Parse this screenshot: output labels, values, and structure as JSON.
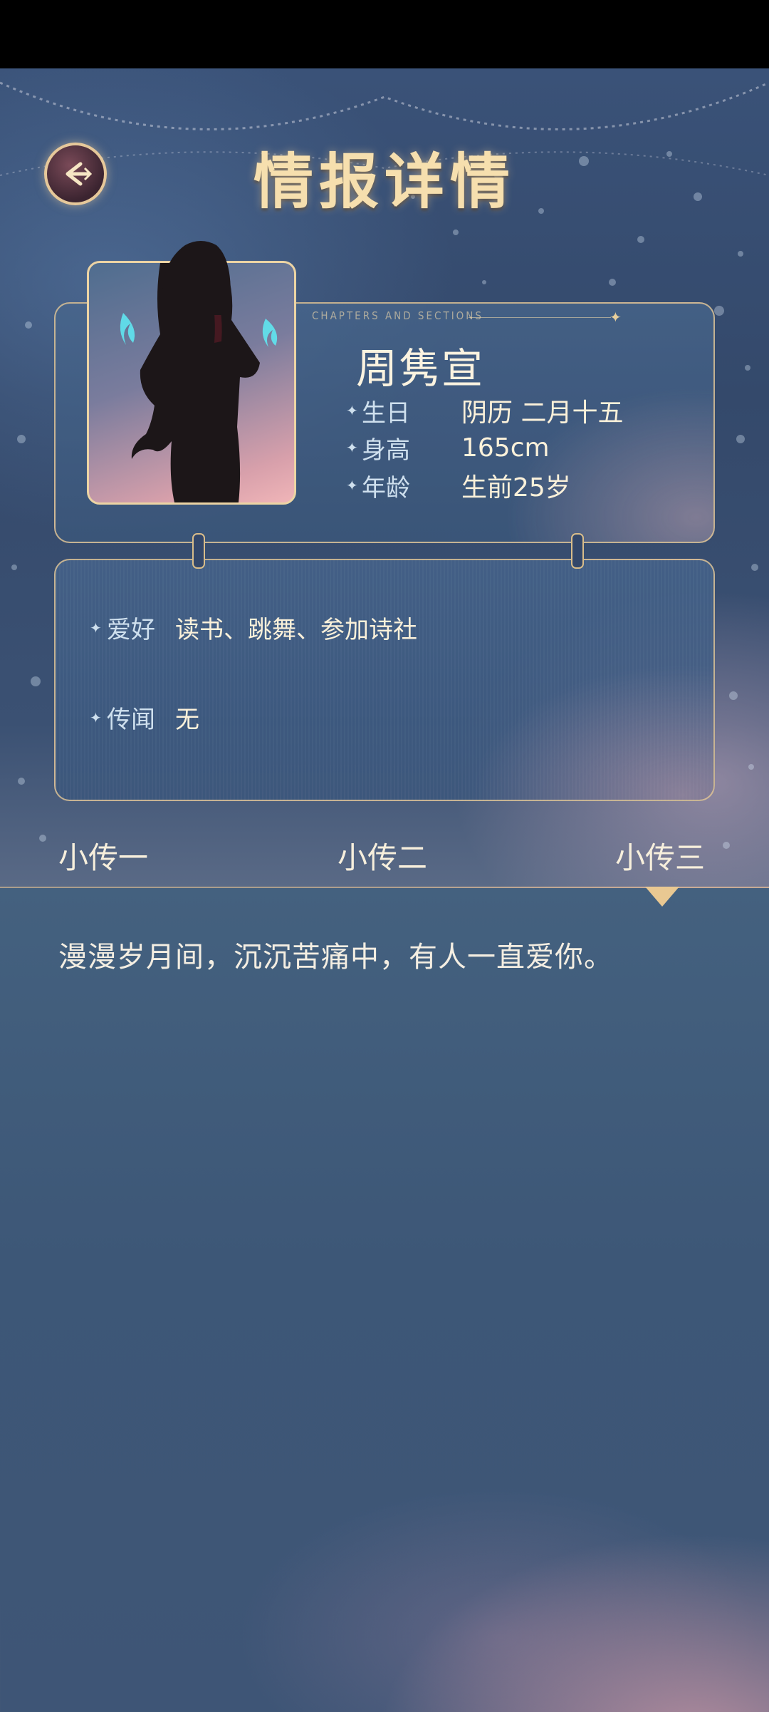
{
  "header": {
    "title": "情报详情",
    "back_icon": "back-arrow-icon",
    "chapters_label": "CHAPTERS AND SECTIONS"
  },
  "profile": {
    "name": "周隽宣",
    "stats": [
      {
        "label": "生日",
        "value": "阴历 二月十五"
      },
      {
        "label": "身高",
        "value": "165cm"
      },
      {
        "label": "年龄",
        "value": "生前25岁"
      }
    ]
  },
  "details": [
    {
      "label": "爱好",
      "value": "读书、跳舞、参加诗社"
    },
    {
      "label": "传闻",
      "value": "无"
    }
  ],
  "tabs": [
    {
      "label": "小传一",
      "active": false
    },
    {
      "label": "小传二",
      "active": false
    },
    {
      "label": "小传三",
      "active": true
    }
  ],
  "story": {
    "text": "漫漫岁月间，沉沉苦痛中，有人一直爱你。"
  },
  "colors": {
    "gold": "#e8cf9c",
    "title": "#f6dfae",
    "panel": "#3e5576"
  }
}
